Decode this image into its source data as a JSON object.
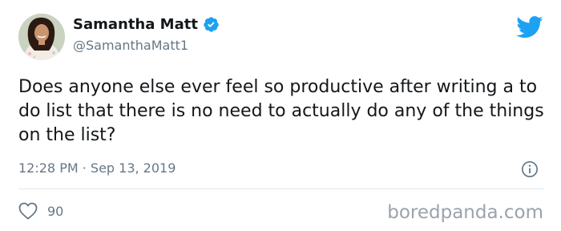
{
  "tweet": {
    "author_name": "Samantha Matt",
    "author_handle": "@SamanthaMatt1",
    "text": "Does anyone else ever feel so productive after writing a to do list that there is no need to actually do any of the things on the list?",
    "timestamp": "12:28 PM · Sep 13, 2019",
    "like_count": "90"
  },
  "icons": {
    "verified": "verified-badge-icon",
    "platform": "twitter-bird-icon",
    "info": "info-icon",
    "like": "heart-outline-icon"
  },
  "colors": {
    "twitter_blue": "#1da1f2",
    "secondary_text": "#657786"
  },
  "watermark": "boredpanda.com"
}
